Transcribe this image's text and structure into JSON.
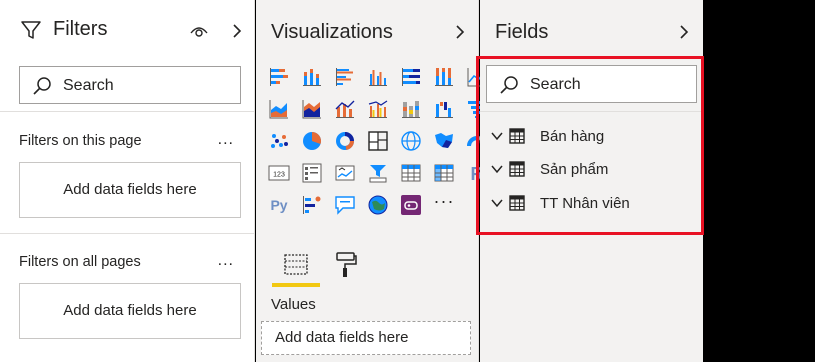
{
  "filters": {
    "title": "Filters",
    "search_placeholder": "Search",
    "page_section": "Filters on this page",
    "page_more": "...",
    "page_well": "Add data fields here",
    "all_section": "Filters on all pages",
    "all_more": "...",
    "all_well": "Add data fields here"
  },
  "visualizations": {
    "title": "Visualizations",
    "values_label": "Values",
    "values_well": "Add data fields here",
    "icons": [
      "stacked-bar-chart-icon",
      "stacked-column-chart-icon",
      "clustered-bar-chart-icon",
      "clustered-column-chart-icon",
      "100-stacked-bar-chart-icon",
      "100-stacked-column-chart-icon",
      "line-chart-icon",
      "area-chart-icon",
      "stacked-area-chart-icon",
      "line-and-stacked-column-chart-icon",
      "line-and-clustered-column-chart-icon",
      "ribbon-chart-icon",
      "waterfall-chart-icon",
      "funnel-chart-icon",
      "scatter-chart-icon",
      "pie-chart-icon",
      "donut-chart-icon",
      "treemap-icon",
      "map-icon",
      "filled-map-icon",
      "gauge-icon",
      "card-icon",
      "multi-row-card-icon",
      "kpi-icon",
      "slicer-icon",
      "table-icon",
      "matrix-icon",
      "r-script-visual-icon",
      "python-visual-icon",
      "key-influencers-icon",
      "qa-visual-icon",
      "arcgis-map-icon",
      "power-apps-icon",
      "more-visuals-icon"
    ],
    "r_text": "R",
    "py_text": "Py",
    "more_text": "···"
  },
  "fields": {
    "title": "Fields",
    "search_placeholder": "Search",
    "tables": [
      "Bán hàng",
      "Sản phẩm",
      "TT Nhân viên"
    ]
  },
  "colors": {
    "highlight_border": "#e81123",
    "accent_yellow": "#f2c811",
    "chart_blue": "#118dff",
    "chart_orange": "#e66c37",
    "chart_navy": "#12239e"
  }
}
